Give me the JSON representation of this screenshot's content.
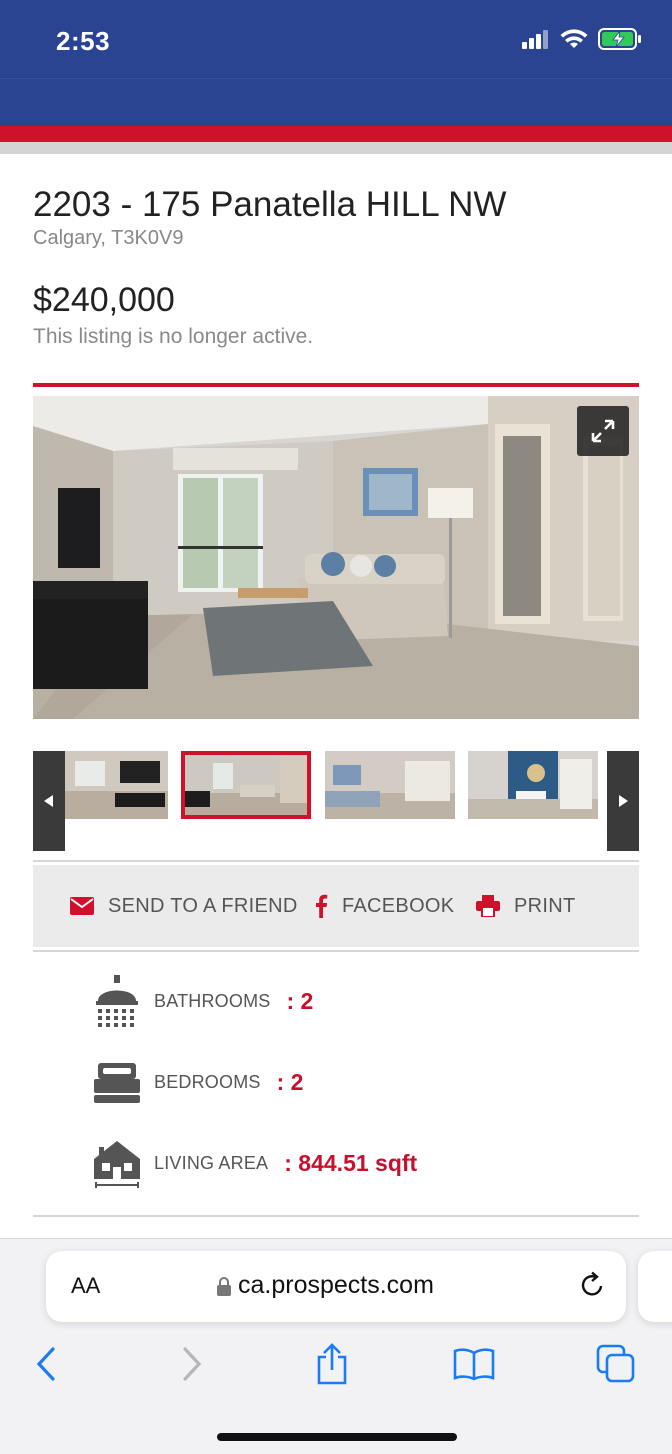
{
  "status_bar": {
    "time": "2:53"
  },
  "listing": {
    "address": "2203 - 175 Panatella HILL NW",
    "city": "Calgary, T3K0V9",
    "price": "$240,000",
    "status": "This listing is no longer active."
  },
  "gallery": {
    "active_thumbnail_index": 1,
    "thumbnail_count_visible": 4
  },
  "share": {
    "send_label": "SEND TO A FRIEND",
    "facebook_label": "FACEBOOK",
    "print_label": "PRINT"
  },
  "features": [
    {
      "label": "BATHROOMS",
      "value": ": 2",
      "icon": "shower-icon"
    },
    {
      "label": "BEDROOMS",
      "value": ": 2",
      "icon": "bed-icon"
    },
    {
      "label": "LIVING AREA",
      "value": ": 844.51 sqft",
      "icon": "house-area-icon"
    }
  ],
  "browser": {
    "text_size_label": "AA",
    "url": "ca.prospects.com"
  },
  "colors": {
    "header_blue": "#2a4491",
    "accent_red": "#d0112b",
    "value_red": "#c8102e",
    "ios_blue": "#1a7cf5"
  }
}
